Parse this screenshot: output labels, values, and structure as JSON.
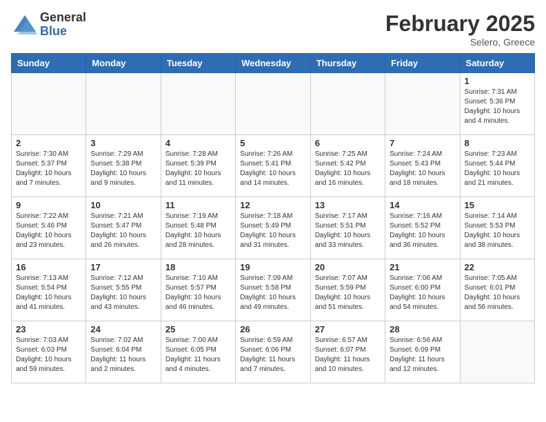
{
  "logo": {
    "general": "General",
    "blue": "Blue"
  },
  "title": "February 2025",
  "location": "Selero, Greece",
  "weekdays": [
    "Sunday",
    "Monday",
    "Tuesday",
    "Wednesday",
    "Thursday",
    "Friday",
    "Saturday"
  ],
  "weeks": [
    [
      {
        "day": "",
        "info": ""
      },
      {
        "day": "",
        "info": ""
      },
      {
        "day": "",
        "info": ""
      },
      {
        "day": "",
        "info": ""
      },
      {
        "day": "",
        "info": ""
      },
      {
        "day": "",
        "info": ""
      },
      {
        "day": "1",
        "info": "Sunrise: 7:31 AM\nSunset: 5:36 PM\nDaylight: 10 hours and 4 minutes."
      }
    ],
    [
      {
        "day": "2",
        "info": "Sunrise: 7:30 AM\nSunset: 5:37 PM\nDaylight: 10 hours and 7 minutes."
      },
      {
        "day": "3",
        "info": "Sunrise: 7:29 AM\nSunset: 5:38 PM\nDaylight: 10 hours and 9 minutes."
      },
      {
        "day": "4",
        "info": "Sunrise: 7:28 AM\nSunset: 5:39 PM\nDaylight: 10 hours and 11 minutes."
      },
      {
        "day": "5",
        "info": "Sunrise: 7:26 AM\nSunset: 5:41 PM\nDaylight: 10 hours and 14 minutes."
      },
      {
        "day": "6",
        "info": "Sunrise: 7:25 AM\nSunset: 5:42 PM\nDaylight: 10 hours and 16 minutes."
      },
      {
        "day": "7",
        "info": "Sunrise: 7:24 AM\nSunset: 5:43 PM\nDaylight: 10 hours and 18 minutes."
      },
      {
        "day": "8",
        "info": "Sunrise: 7:23 AM\nSunset: 5:44 PM\nDaylight: 10 hours and 21 minutes."
      }
    ],
    [
      {
        "day": "9",
        "info": "Sunrise: 7:22 AM\nSunset: 5:46 PM\nDaylight: 10 hours and 23 minutes."
      },
      {
        "day": "10",
        "info": "Sunrise: 7:21 AM\nSunset: 5:47 PM\nDaylight: 10 hours and 26 minutes."
      },
      {
        "day": "11",
        "info": "Sunrise: 7:19 AM\nSunset: 5:48 PM\nDaylight: 10 hours and 28 minutes."
      },
      {
        "day": "12",
        "info": "Sunrise: 7:18 AM\nSunset: 5:49 PM\nDaylight: 10 hours and 31 minutes."
      },
      {
        "day": "13",
        "info": "Sunrise: 7:17 AM\nSunset: 5:51 PM\nDaylight: 10 hours and 33 minutes."
      },
      {
        "day": "14",
        "info": "Sunrise: 7:16 AM\nSunset: 5:52 PM\nDaylight: 10 hours and 36 minutes."
      },
      {
        "day": "15",
        "info": "Sunrise: 7:14 AM\nSunset: 5:53 PM\nDaylight: 10 hours and 38 minutes."
      }
    ],
    [
      {
        "day": "16",
        "info": "Sunrise: 7:13 AM\nSunset: 5:54 PM\nDaylight: 10 hours and 41 minutes."
      },
      {
        "day": "17",
        "info": "Sunrise: 7:12 AM\nSunset: 5:55 PM\nDaylight: 10 hours and 43 minutes."
      },
      {
        "day": "18",
        "info": "Sunrise: 7:10 AM\nSunset: 5:57 PM\nDaylight: 10 hours and 46 minutes."
      },
      {
        "day": "19",
        "info": "Sunrise: 7:09 AM\nSunset: 5:58 PM\nDaylight: 10 hours and 49 minutes."
      },
      {
        "day": "20",
        "info": "Sunrise: 7:07 AM\nSunset: 5:59 PM\nDaylight: 10 hours and 51 minutes."
      },
      {
        "day": "21",
        "info": "Sunrise: 7:06 AM\nSunset: 6:00 PM\nDaylight: 10 hours and 54 minutes."
      },
      {
        "day": "22",
        "info": "Sunrise: 7:05 AM\nSunset: 6:01 PM\nDaylight: 10 hours and 56 minutes."
      }
    ],
    [
      {
        "day": "23",
        "info": "Sunrise: 7:03 AM\nSunset: 6:03 PM\nDaylight: 10 hours and 59 minutes."
      },
      {
        "day": "24",
        "info": "Sunrise: 7:02 AM\nSunset: 6:04 PM\nDaylight: 11 hours and 2 minutes."
      },
      {
        "day": "25",
        "info": "Sunrise: 7:00 AM\nSunset: 6:05 PM\nDaylight: 11 hours and 4 minutes."
      },
      {
        "day": "26",
        "info": "Sunrise: 6:59 AM\nSunset: 6:06 PM\nDaylight: 11 hours and 7 minutes."
      },
      {
        "day": "27",
        "info": "Sunrise: 6:57 AM\nSunset: 6:07 PM\nDaylight: 11 hours and 10 minutes."
      },
      {
        "day": "28",
        "info": "Sunrise: 6:56 AM\nSunset: 6:09 PM\nDaylight: 11 hours and 12 minutes."
      },
      {
        "day": "",
        "info": ""
      }
    ]
  ]
}
